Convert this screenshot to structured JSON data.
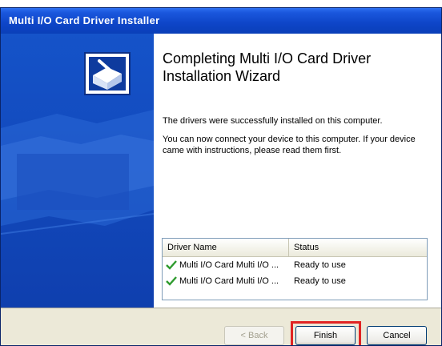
{
  "window": {
    "title": "Multi I/O Card Driver Installer"
  },
  "wizard": {
    "heading": "Completing Multi I/O Card Driver Installation Wizard",
    "paragraph1": "The drivers were successfully installed on this computer.",
    "paragraph2": "You can now connect your device to this computer. If your device came with instructions, please read them first."
  },
  "driver_list": {
    "columns": [
      "Driver Name",
      "Status"
    ],
    "rows": [
      {
        "name": "Multi I/O Card Multi I/O ...",
        "status": "Ready to use"
      },
      {
        "name": "Multi I/O Card Multi I/O ...",
        "status": "Ready to use"
      }
    ]
  },
  "buttons": {
    "back": "< Back",
    "finish": "Finish",
    "cancel": "Cancel"
  },
  "colors": {
    "title_bar": "#0e45c8",
    "left_panel": "#1553c9",
    "check": "#2e9b2e",
    "highlight": "#e02424"
  },
  "icons": {
    "wizard": "install-box-icon",
    "row_status": "green-check-icon"
  }
}
